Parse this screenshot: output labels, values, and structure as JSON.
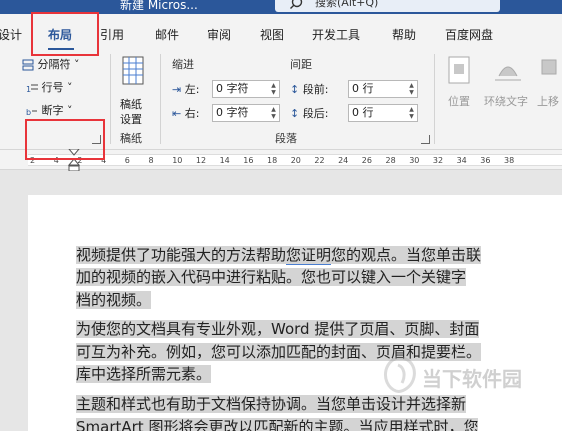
{
  "titlebar": {
    "doc_title": "新建 Micros...",
    "search": "搜索(Alt+Q)"
  },
  "tabs": [
    {
      "label": "设计"
    },
    {
      "label": "布局"
    },
    {
      "label": "引用"
    },
    {
      "label": "邮件"
    },
    {
      "label": "审阅"
    },
    {
      "label": "视图"
    },
    {
      "label": "开发工具"
    },
    {
      "label": "帮助"
    },
    {
      "label": "百度网盘"
    }
  ],
  "ribbon": {
    "page_setup": {
      "breaks": "分隔符",
      "line_numbers": "行号",
      "hyphenation": "断字"
    },
    "manuscript": {
      "button": "稿纸设置",
      "button_line1": "稿纸",
      "button_line2": "设置",
      "group": "稿纸"
    },
    "indent": {
      "title": "缩进",
      "left_label": "左:",
      "left_value": "0 字符",
      "right_label": "右:",
      "right_value": "0 字符"
    },
    "spacing": {
      "title": "间距",
      "before_label": "段前:",
      "before_value": "0 行",
      "after_label": "段后:",
      "after_value": "0 行"
    },
    "paragraph_group": "段落",
    "arrange": {
      "position": "位置",
      "wrap_text": "环绕文字",
      "bring_forward": "上移"
    }
  },
  "ruler": {
    "numbers": [
      "2",
      "4",
      "2",
      "4",
      "6",
      "8",
      "10",
      "12",
      "14",
      "16",
      "18",
      "20",
      "22",
      "24",
      "26",
      "28",
      "30",
      "32",
      "34",
      "36",
      "38"
    ]
  },
  "document": {
    "lines": [
      {
        "text": "视频提供了功能强大的方法帮助",
        "u": "您证明",
        "rest": "您的观点。当您单击联"
      },
      {
        "text": "加的视频的嵌入代码中进行粘贴。您也可以键入一个关键字"
      },
      {
        "text": "档的视频。"
      },
      {
        "text": "为使您的文档具有专业外观，Word 提供了页眉、页脚、封面"
      },
      {
        "text": "可互为补充。例如，您可以添加匹配的封面、页眉和提要栏。"
      },
      {
        "text": "库中选择所需元素。"
      },
      {
        "text": "主题和样式也有助于文档保持协调。当您单击设计并选择新"
      },
      {
        "text": "SmartArt 图形将会更改以匹配新的主题。当应用样式时，您"
      }
    ]
  },
  "watermark": "当下软件园",
  "colors": {
    "accent": "#2b579a",
    "highlight_box": "#e8343a",
    "selection": "#d4d4d4"
  }
}
